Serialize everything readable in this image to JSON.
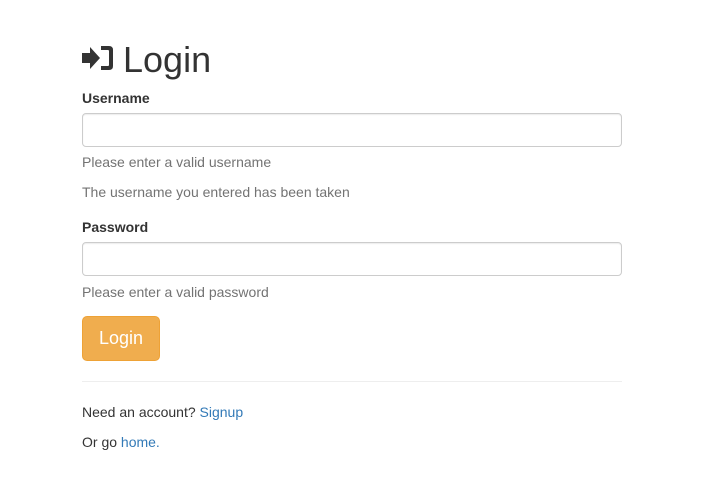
{
  "heading": {
    "icon": "sign-in-icon",
    "title": "Login"
  },
  "username": {
    "label": "Username",
    "value": "",
    "placeholder": "",
    "help_invalid": "Please enter a valid username",
    "help_taken": "The username you entered has been taken"
  },
  "password": {
    "label": "Password",
    "value": "",
    "placeholder": "",
    "help_invalid": "Please enter a valid password"
  },
  "login_button": {
    "label": "Login",
    "color": "#f0ad4e"
  },
  "footer": {
    "signup_prompt": "Need an account? ",
    "signup_link": "Signup",
    "home_prompt": "Or go ",
    "home_link": "home.",
    "link_color": "#337ab7"
  }
}
